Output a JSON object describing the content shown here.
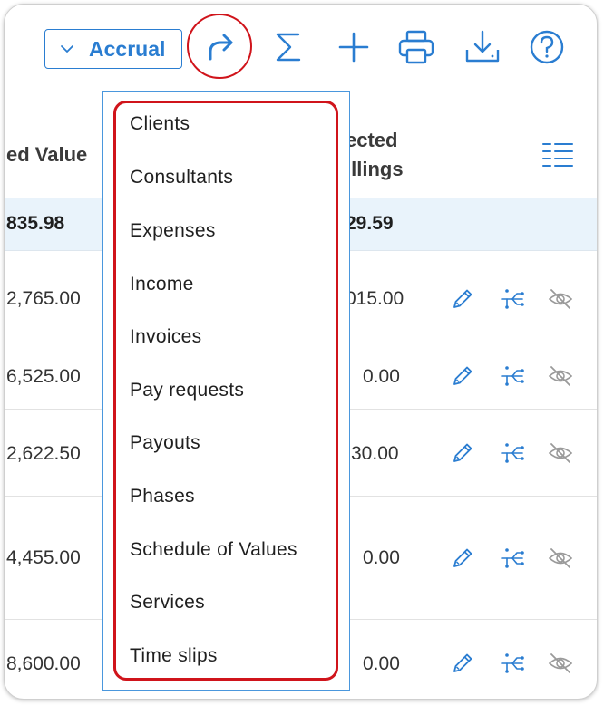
{
  "toolbar": {
    "accrual_label": "Accrual",
    "icons": [
      "chevron-down-icon",
      "share-forward-icon",
      "sigma-icon",
      "plus-icon",
      "printer-icon",
      "download-icon",
      "help-icon"
    ]
  },
  "table": {
    "headers": {
      "value_col": "ed Value",
      "billings_line1": "ected",
      "billings_line2": "illings"
    },
    "total": {
      "value": "835.98",
      "billings": "29.59"
    },
    "rows": [
      {
        "value": "2,765.00",
        "billings": "015.00"
      },
      {
        "value": "6,525.00",
        "billings": "0.00"
      },
      {
        "value": "2,622.50",
        "billings": "30.00"
      },
      {
        "value": "4,455.00",
        "billings": "0.00"
      },
      {
        "value": "8,600.00",
        "billings": "0.00"
      }
    ],
    "row_action_icons": [
      "pencil-icon",
      "split-icon",
      "eye-slash-icon"
    ]
  },
  "dropdown": {
    "items": [
      "Clients",
      "Consultants",
      "Expenses",
      "Income",
      "Invoices",
      "Pay requests",
      "Payouts",
      "Phases",
      "Schedule of Values",
      "Services",
      "Time slips"
    ]
  },
  "colors": {
    "accent": "#2a7dd1",
    "highlight": "#d0141b",
    "total_row_bg": "#e9f3fb"
  }
}
